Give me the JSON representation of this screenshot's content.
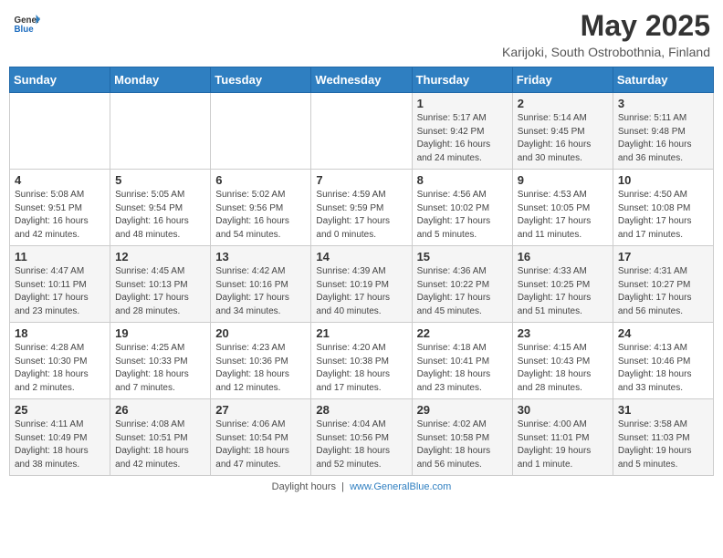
{
  "header": {
    "logo_general": "General",
    "logo_blue": "Blue",
    "month_title": "May 2025",
    "location": "Karijoki, South Ostrobothnia, Finland"
  },
  "weekdays": [
    "Sunday",
    "Monday",
    "Tuesday",
    "Wednesday",
    "Thursday",
    "Friday",
    "Saturday"
  ],
  "weeks": [
    [
      {
        "day": "",
        "info": ""
      },
      {
        "day": "",
        "info": ""
      },
      {
        "day": "",
        "info": ""
      },
      {
        "day": "",
        "info": ""
      },
      {
        "day": "1",
        "info": "Sunrise: 5:17 AM\nSunset: 9:42 PM\nDaylight: 16 hours\nand 24 minutes."
      },
      {
        "day": "2",
        "info": "Sunrise: 5:14 AM\nSunset: 9:45 PM\nDaylight: 16 hours\nand 30 minutes."
      },
      {
        "day": "3",
        "info": "Sunrise: 5:11 AM\nSunset: 9:48 PM\nDaylight: 16 hours\nand 36 minutes."
      }
    ],
    [
      {
        "day": "4",
        "info": "Sunrise: 5:08 AM\nSunset: 9:51 PM\nDaylight: 16 hours\nand 42 minutes."
      },
      {
        "day": "5",
        "info": "Sunrise: 5:05 AM\nSunset: 9:54 PM\nDaylight: 16 hours\nand 48 minutes."
      },
      {
        "day": "6",
        "info": "Sunrise: 5:02 AM\nSunset: 9:56 PM\nDaylight: 16 hours\nand 54 minutes."
      },
      {
        "day": "7",
        "info": "Sunrise: 4:59 AM\nSunset: 9:59 PM\nDaylight: 17 hours\nand 0 minutes."
      },
      {
        "day": "8",
        "info": "Sunrise: 4:56 AM\nSunset: 10:02 PM\nDaylight: 17 hours\nand 5 minutes."
      },
      {
        "day": "9",
        "info": "Sunrise: 4:53 AM\nSunset: 10:05 PM\nDaylight: 17 hours\nand 11 minutes."
      },
      {
        "day": "10",
        "info": "Sunrise: 4:50 AM\nSunset: 10:08 PM\nDaylight: 17 hours\nand 17 minutes."
      }
    ],
    [
      {
        "day": "11",
        "info": "Sunrise: 4:47 AM\nSunset: 10:11 PM\nDaylight: 17 hours\nand 23 minutes."
      },
      {
        "day": "12",
        "info": "Sunrise: 4:45 AM\nSunset: 10:13 PM\nDaylight: 17 hours\nand 28 minutes."
      },
      {
        "day": "13",
        "info": "Sunrise: 4:42 AM\nSunset: 10:16 PM\nDaylight: 17 hours\nand 34 minutes."
      },
      {
        "day": "14",
        "info": "Sunrise: 4:39 AM\nSunset: 10:19 PM\nDaylight: 17 hours\nand 40 minutes."
      },
      {
        "day": "15",
        "info": "Sunrise: 4:36 AM\nSunset: 10:22 PM\nDaylight: 17 hours\nand 45 minutes."
      },
      {
        "day": "16",
        "info": "Sunrise: 4:33 AM\nSunset: 10:25 PM\nDaylight: 17 hours\nand 51 minutes."
      },
      {
        "day": "17",
        "info": "Sunrise: 4:31 AM\nSunset: 10:27 PM\nDaylight: 17 hours\nand 56 minutes."
      }
    ],
    [
      {
        "day": "18",
        "info": "Sunrise: 4:28 AM\nSunset: 10:30 PM\nDaylight: 18 hours\nand 2 minutes."
      },
      {
        "day": "19",
        "info": "Sunrise: 4:25 AM\nSunset: 10:33 PM\nDaylight: 18 hours\nand 7 minutes."
      },
      {
        "day": "20",
        "info": "Sunrise: 4:23 AM\nSunset: 10:36 PM\nDaylight: 18 hours\nand 12 minutes."
      },
      {
        "day": "21",
        "info": "Sunrise: 4:20 AM\nSunset: 10:38 PM\nDaylight: 18 hours\nand 17 minutes."
      },
      {
        "day": "22",
        "info": "Sunrise: 4:18 AM\nSunset: 10:41 PM\nDaylight: 18 hours\nand 23 minutes."
      },
      {
        "day": "23",
        "info": "Sunrise: 4:15 AM\nSunset: 10:43 PM\nDaylight: 18 hours\nand 28 minutes."
      },
      {
        "day": "24",
        "info": "Sunrise: 4:13 AM\nSunset: 10:46 PM\nDaylight: 18 hours\nand 33 minutes."
      }
    ],
    [
      {
        "day": "25",
        "info": "Sunrise: 4:11 AM\nSunset: 10:49 PM\nDaylight: 18 hours\nand 38 minutes."
      },
      {
        "day": "26",
        "info": "Sunrise: 4:08 AM\nSunset: 10:51 PM\nDaylight: 18 hours\nand 42 minutes."
      },
      {
        "day": "27",
        "info": "Sunrise: 4:06 AM\nSunset: 10:54 PM\nDaylight: 18 hours\nand 47 minutes."
      },
      {
        "day": "28",
        "info": "Sunrise: 4:04 AM\nSunset: 10:56 PM\nDaylight: 18 hours\nand 52 minutes."
      },
      {
        "day": "29",
        "info": "Sunrise: 4:02 AM\nSunset: 10:58 PM\nDaylight: 18 hours\nand 56 minutes."
      },
      {
        "day": "30",
        "info": "Sunrise: 4:00 AM\nSunset: 11:01 PM\nDaylight: 19 hours\nand 1 minute."
      },
      {
        "day": "31",
        "info": "Sunrise: 3:58 AM\nSunset: 11:03 PM\nDaylight: 19 hours\nand 5 minutes."
      }
    ]
  ],
  "footer": {
    "text": "Daylight hours",
    "url_text": "www.GeneralBlue.com"
  }
}
